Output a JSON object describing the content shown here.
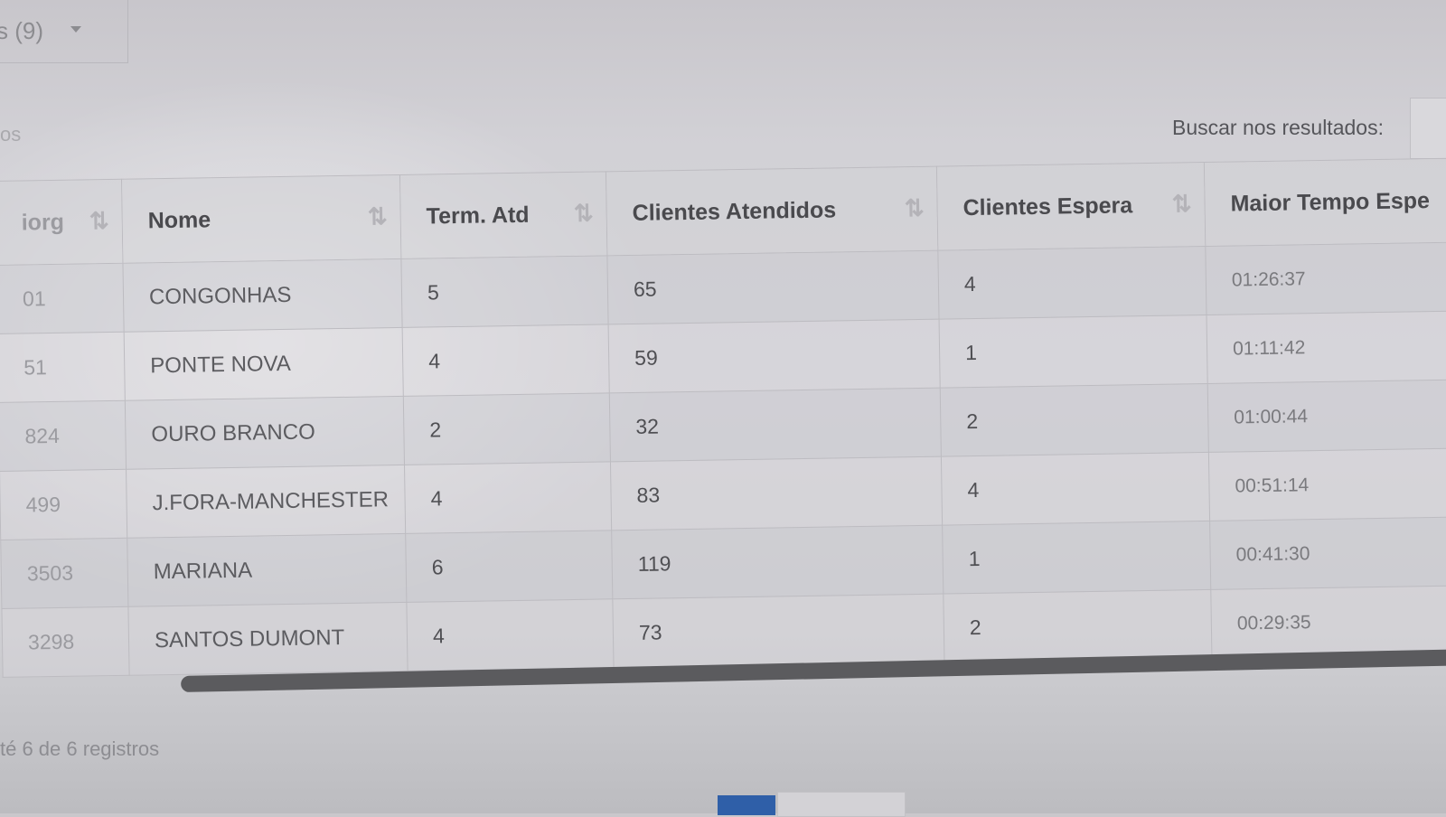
{
  "filter_dropdown": {
    "label": "s (9)"
  },
  "left_partial_label": "os",
  "search": {
    "label": "Buscar nos resultados:"
  },
  "table": {
    "headers": {
      "col0": "iorg",
      "nome": "Nome",
      "term_atd": "Term. Atd",
      "clientes_atendidos": "Clientes Atendidos",
      "clientes_espera": "Clientes Espera",
      "maior_tempo": "Maior Tempo Espe"
    },
    "rows": [
      {
        "code": "01",
        "nome": "CONGONHAS",
        "term": "5",
        "atendidos": "65",
        "espera": "4",
        "tempo": "01:26:37"
      },
      {
        "code": "51",
        "nome": "PONTE NOVA",
        "term": "4",
        "atendidos": "59",
        "espera": "1",
        "tempo": "01:11:42"
      },
      {
        "code": "824",
        "nome": "OURO BRANCO",
        "term": "2",
        "atendidos": "32",
        "espera": "2",
        "tempo": "01:00:44"
      },
      {
        "code": "499",
        "nome": "J.FORA-MANCHESTER",
        "term": "4",
        "atendidos": "83",
        "espera": "4",
        "tempo": "00:51:14"
      },
      {
        "code": "3503",
        "nome": "MARIANA",
        "term": "6",
        "atendidos": "119",
        "espera": "1",
        "tempo": "00:41:30"
      },
      {
        "code": "3298",
        "nome": "SANTOS DUMONT",
        "term": "4",
        "atendidos": "73",
        "espera": "2",
        "tempo": "00:29:35"
      }
    ]
  },
  "footer": {
    "info": "té 6 de 6 registros"
  },
  "icons": {
    "sort": "sort-arrows-icon",
    "caret": "caret-down-icon"
  }
}
